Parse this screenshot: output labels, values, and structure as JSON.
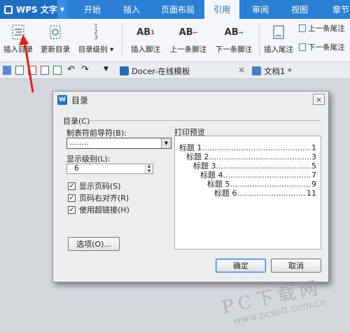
{
  "app": {
    "title": "WPS 文字"
  },
  "tabs": [
    {
      "label": "开始"
    },
    {
      "label": "插入"
    },
    {
      "label": "页面布局"
    },
    {
      "label": "引用"
    },
    {
      "label": "审阅"
    },
    {
      "label": "视图"
    },
    {
      "label": "章节"
    }
  ],
  "ribbon": {
    "insert_toc": "插入目录",
    "update_toc": "更新目录",
    "toc_level": "目录级别",
    "insert_footnote": "插入脚注",
    "prev_footnote": "上一条脚注",
    "next_footnote": "下一条脚注",
    "insert_endnote": "插入尾注",
    "prev_endnote": "上一条尾注",
    "next_endnote": "下一条尾注",
    "icon_text_ab": "AB",
    "icon_sup_1": "1",
    "icon_toc_nums": [
      "1",
      "2",
      "3"
    ]
  },
  "doc_tabs": [
    {
      "label": "Docer-在线模板"
    },
    {
      "label": "文档1 *"
    }
  ],
  "dialog": {
    "title": "目录",
    "group_label": "目录(C)",
    "leader_label": "制表符前导符(B):",
    "leader_value": "........",
    "level_label": "显示级别(L):",
    "level_value": "6",
    "show_page_numbers": "显示页码(S)",
    "right_align": "页码右对齐(R)",
    "use_hyperlinks": "使用超链接(H)",
    "preview_label": "打印预览",
    "options_button": "选项(O)...",
    "ok_button": "确定",
    "cancel_button": "取消",
    "close_glyph": "×",
    "preview": [
      {
        "text": "标题 1",
        "page": "1"
      },
      {
        "text": "标题 2",
        "page": "3"
      },
      {
        "text": "标题 3",
        "page": "5"
      },
      {
        "text": "标题 4",
        "page": "7"
      },
      {
        "text": "标题 5",
        "page": "9"
      },
      {
        "text": "标题 6",
        "page": "11"
      }
    ]
  },
  "watermark": {
    "brand": "PC下载网",
    "url": "www.pcsoft.com.cn"
  },
  "colors": {
    "accent": "#2b7fd4",
    "arrow": "#e02020"
  }
}
